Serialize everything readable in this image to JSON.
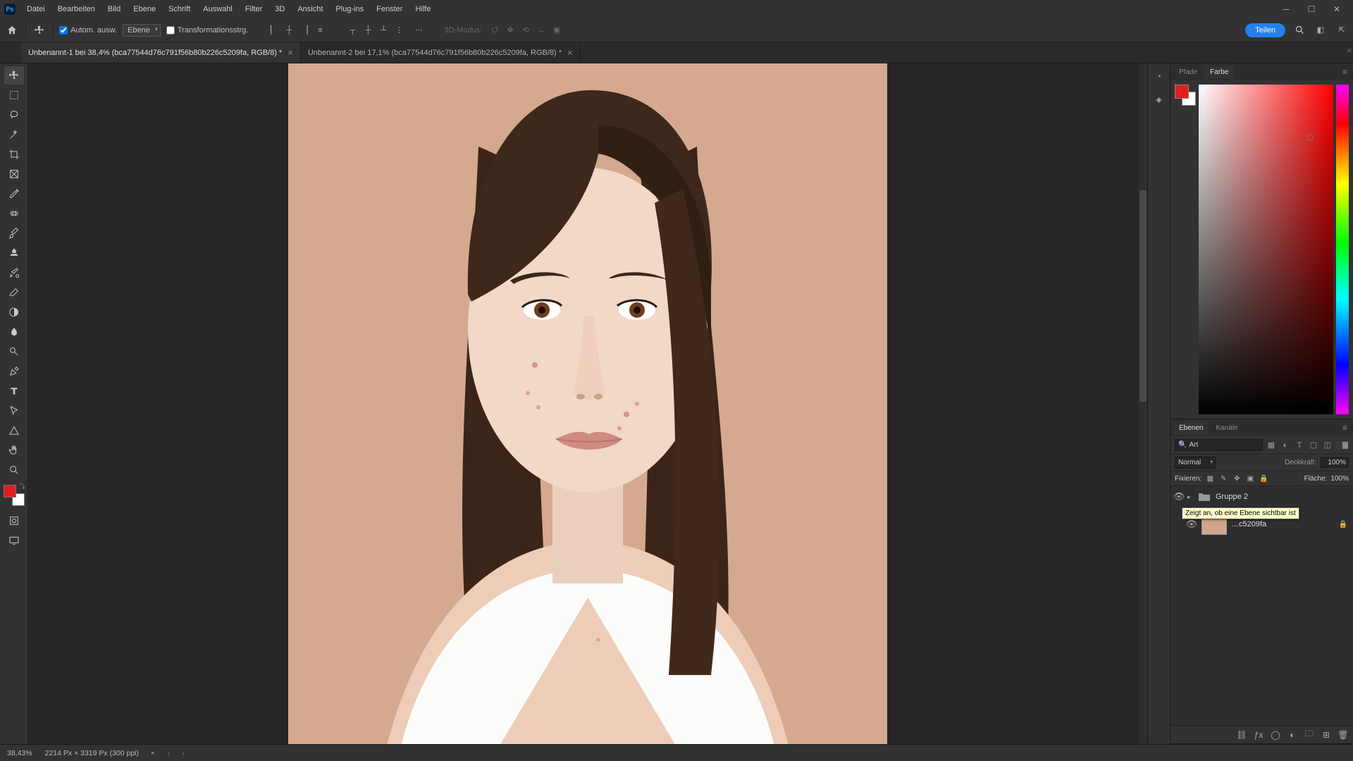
{
  "app_logo": "Ps",
  "menu": {
    "items": [
      "Datei",
      "Bearbeiten",
      "Bild",
      "Ebene",
      "Schrift",
      "Auswahl",
      "Filter",
      "3D",
      "Ansicht",
      "Plug-ins",
      "Fenster",
      "Hilfe"
    ]
  },
  "options": {
    "auto_select_label": "Autom. ausw.",
    "target_dd": "Ebene",
    "transform_label": "Transformationsstrg.",
    "mode_3d_label": "3D-Modus:",
    "share_label": "Teilen"
  },
  "tabs": [
    {
      "title": "Unbenannt-1 bei 38,4% (bca77544d76c791f56b80b226c5209fa, RGB/8) *",
      "active": true
    },
    {
      "title": "Unbenannt-2 bei 17,1% (bca77544d76c791f56b80b226c5209fa, RGB/8) *",
      "active": false
    }
  ],
  "color_panel": {
    "tabs": [
      "Pfade",
      "Farbe"
    ],
    "active_tab": 1
  },
  "layers_panel": {
    "tabs": [
      "Ebenen",
      "Kanäle"
    ],
    "active_tab": 0,
    "filter_label": "Art",
    "blend_mode": "Normal",
    "opacity_label": "Deckkraft:",
    "opacity_value": "100%",
    "lock_label": "Fixieren:",
    "fill_label": "Fläche:",
    "fill_value": "100%",
    "group_name": "Gruppe 2",
    "tooltip": "Zeigt an, ob eine Ebene sichtbar ist",
    "bg_layer_suffix": "c5209fa"
  },
  "status": {
    "zoom": "38,43%",
    "dims": "2214 Px × 3319 Px (300 ppi)"
  }
}
